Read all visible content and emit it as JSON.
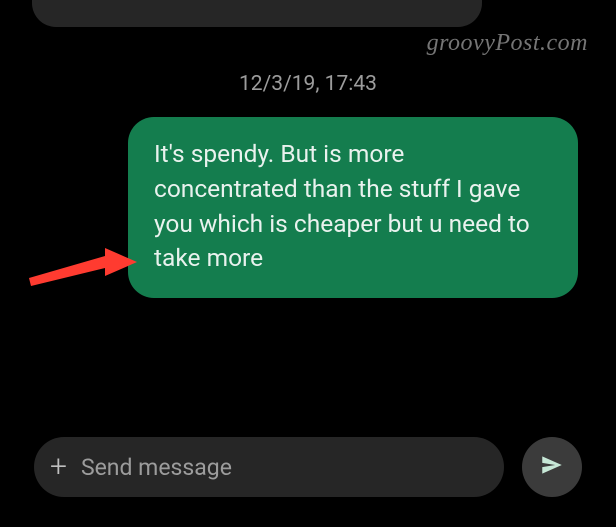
{
  "watermark": "groovyPost.com",
  "timestamp": "12/3/19, 17:43",
  "outgoing_message": "It's spendy. But is more concentrated than the stuff I gave you which is cheaper but u need to take more",
  "compose": {
    "placeholder": "Send message"
  },
  "icons": {
    "plus": "+",
    "send": "send",
    "arrow": "red-arrow"
  },
  "colors": {
    "bubble_out": "#147d4e",
    "bubble_in": "#262626",
    "send_bg": "#3b3b3b",
    "send_arrow": "#c7e8d7"
  }
}
